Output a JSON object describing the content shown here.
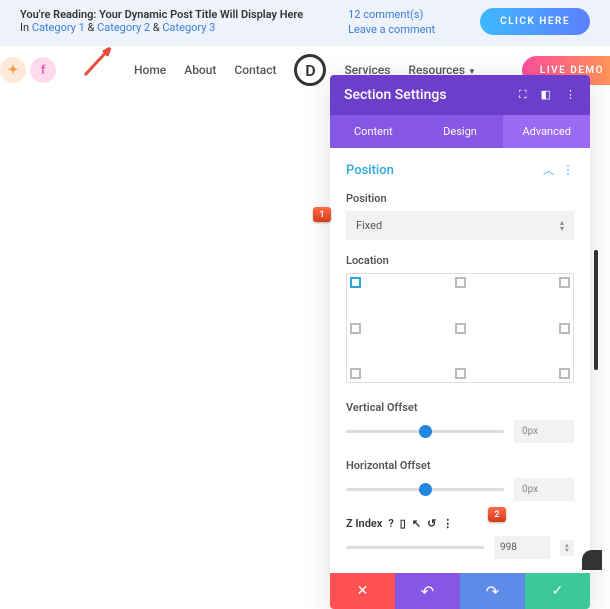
{
  "topbar": {
    "reading_label": "You're Reading:",
    "title": "Your Dynamic Post Title Will Display Here",
    "in_label": "In",
    "cat1": "Category 1",
    "amp": "&",
    "cat2": "Category 2",
    "cat3": "Category 3",
    "comments": "12 comment(s)",
    "leave": "Leave a comment",
    "click_here": "CLICK HERE"
  },
  "nav": {
    "home": "Home",
    "about": "About",
    "contact": "Contact",
    "logo": "D",
    "services": "Services",
    "resources": "Resources",
    "demo": "LIVE DEMO"
  },
  "panel": {
    "title": "Section Settings",
    "tabs": {
      "content": "Content",
      "design": "Design",
      "advanced": "Advanced"
    },
    "section_position": "Position",
    "position_label": "Position",
    "position_value": "Fixed",
    "location_label": "Location",
    "voffset_label": "Vertical Offset",
    "voffset_value": "0px",
    "hoffset_label": "Horizontal Offset",
    "hoffset_value": "0px",
    "zindex_label": "Z Index",
    "zindex_value": "998"
  },
  "badges": {
    "one": "1",
    "two": "2"
  }
}
